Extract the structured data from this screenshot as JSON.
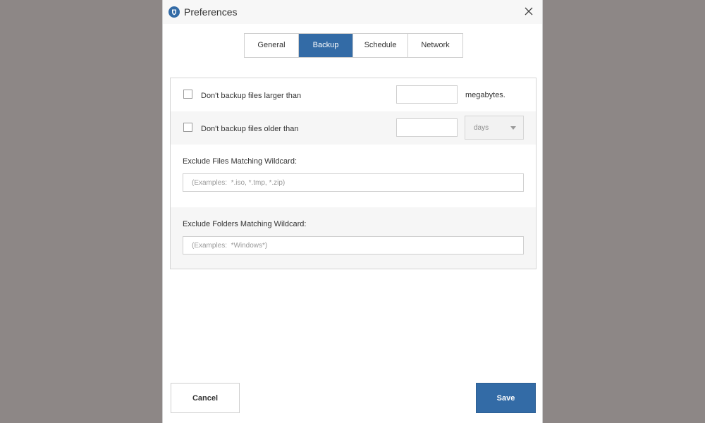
{
  "window": {
    "title": "Preferences",
    "app_icon": "shield-icon",
    "close_icon": "close-icon"
  },
  "tabs": [
    {
      "label": "General",
      "active": false
    },
    {
      "label": "Backup",
      "active": true
    },
    {
      "label": "Schedule",
      "active": false
    },
    {
      "label": "Network",
      "active": false
    }
  ],
  "backup": {
    "size_limit": {
      "label": "Don't backup files larger than",
      "checked": false,
      "value": "",
      "unit": "megabytes."
    },
    "age_limit": {
      "label": "Don't backup files older than",
      "checked": false,
      "value": "",
      "unit_selected": "days"
    },
    "exclude_files": {
      "label": "Exclude Files Matching Wildcard:",
      "placeholder": "(Examples:  *.iso, *.tmp, *.zip)"
    },
    "exclude_folders": {
      "label": "Exclude Folders Matching Wildcard:",
      "placeholder": "(Examples:  *Windows*)"
    }
  },
  "footer": {
    "cancel_label": "Cancel",
    "save_label": "Save"
  },
  "colors": {
    "accent": "#336ba6",
    "backdrop": "#8d8786"
  }
}
